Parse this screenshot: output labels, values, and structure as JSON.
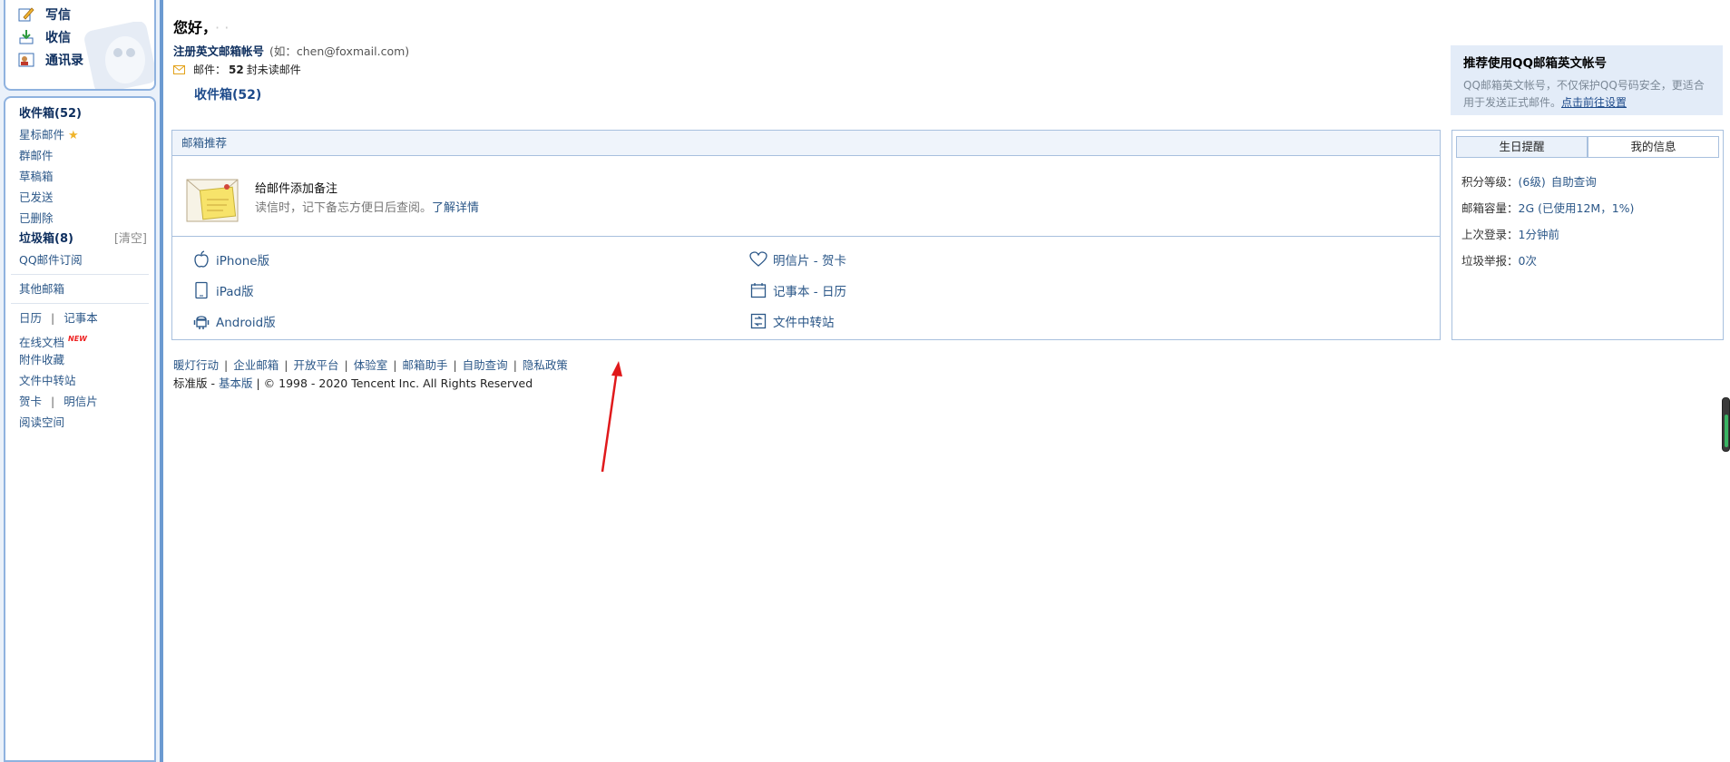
{
  "sidebar": {
    "tools": [
      {
        "label": "写信",
        "icon": "compose-icon"
      },
      {
        "label": "收信",
        "icon": "receive-icon"
      },
      {
        "label": "通讯录",
        "icon": "contacts-icon"
      }
    ],
    "folders": {
      "inbox": "收件箱(52)",
      "starred": "星标邮件",
      "group": "群邮件",
      "drafts": "草稿箱",
      "sent": "已发送",
      "deleted": "已删除",
      "spam": "垃圾箱(8)",
      "spam_clear": "[清空]",
      "subscription": "QQ邮件订阅",
      "other": "其他邮箱",
      "calendar": "日历",
      "notes": "记事本",
      "docs": "在线文档",
      "docs_badge": "NEW",
      "attachments": "附件收藏",
      "transfer": "文件中转站",
      "card": "贺卡",
      "postcard": "明信片",
      "reading": "阅读空间"
    }
  },
  "main": {
    "greeting": "您好，",
    "greeting_name": "· ·",
    "register_link": "注册英文邮箱帐号",
    "register_hint": "(如：chen@foxmail.com)",
    "mail_label": "邮件：",
    "mail_count": "52",
    "mail_suffix": "封未读邮件",
    "inbox_link": "收件箱(52)"
  },
  "promo": {
    "title": "推荐使用QQ邮箱英文帐号",
    "desc": "QQ邮箱英文帐号，不仅保护QQ号码安全，更适合用于发送正式邮件。",
    "link": "点击前往设置"
  },
  "recommend": {
    "header": "邮箱推荐",
    "feature_title": "给邮件添加备注",
    "feature_desc": "读信时，记下备忘方便日后查阅。",
    "feature_link": "了解详情",
    "links": [
      {
        "label": "iPhone版",
        "icon": "apple-icon"
      },
      {
        "label": "iPad版",
        "icon": "ipad-icon"
      },
      {
        "label": "Android版",
        "icon": "android-icon"
      },
      {
        "label": "明信片 - 贺卡",
        "icon": "heart-icon"
      },
      {
        "label": "记事本 - 日历",
        "icon": "calendar-icon"
      },
      {
        "label": "文件中转站",
        "icon": "file-transfer-icon"
      }
    ]
  },
  "info": {
    "tab_birthday": "生日提醒",
    "tab_myinfo": "我的信息",
    "level_label": "积分等级：",
    "level_value": "(6级)",
    "level_link": "自助查询",
    "capacity_label": "邮箱容量：",
    "capacity_value": "2G (已使用12M，1%)",
    "last_login_label": "上次登录：",
    "last_login_value": "1分钟前",
    "spam_report_label": "垃圾举报：",
    "spam_report_value": "0次"
  },
  "footer": {
    "links": [
      "暖灯行动",
      "企业邮箱",
      "开放平台",
      "体验室",
      "邮箱助手",
      "自助查询",
      "隐私政策"
    ],
    "standard": "标准版",
    "basic": "基本版",
    "copyright": "© 1998 - 2020 Tencent Inc. All Rights Reserved"
  },
  "colors": {
    "accent": "#2b5788",
    "border": "#a8c0de",
    "annotation_arrow": "#e0191b"
  }
}
